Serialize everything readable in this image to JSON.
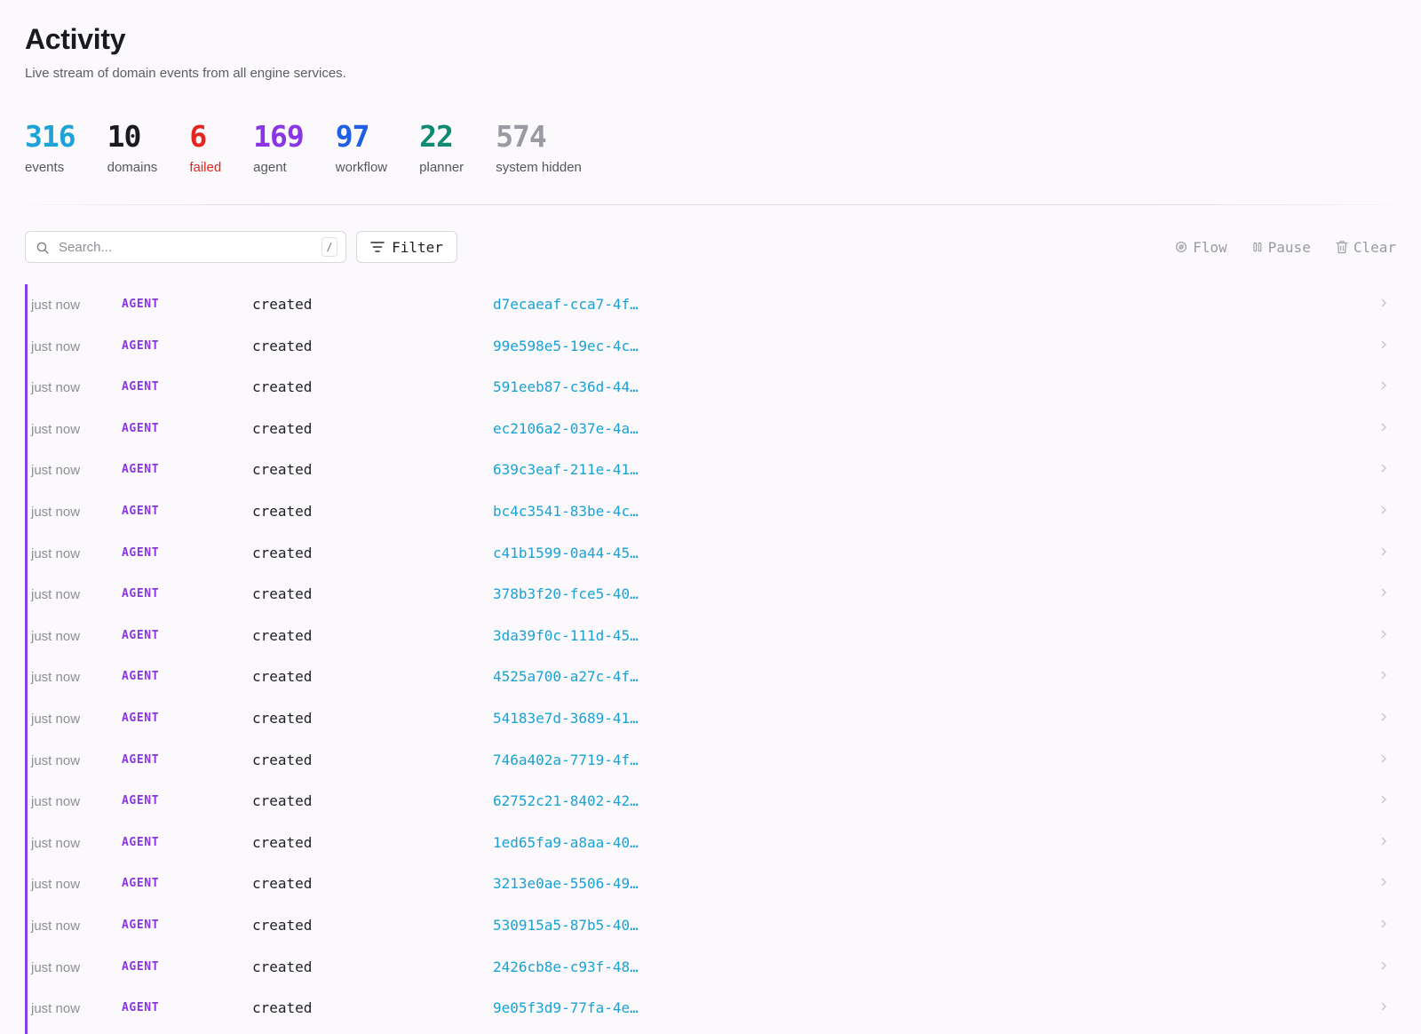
{
  "page": {
    "title": "Activity",
    "subtitle": "Live stream of domain events from all engine services."
  },
  "stats": [
    {
      "value": "316",
      "label": "events",
      "color": "#1da3d8"
    },
    {
      "value": "10",
      "label": "domains",
      "color": "#1a1a1f"
    },
    {
      "value": "6",
      "label": "failed",
      "color": "#e3261f"
    },
    {
      "value": "169",
      "label": "agent",
      "color": "#8a35e6"
    },
    {
      "value": "97",
      "label": "workflow",
      "color": "#1e5fe6"
    },
    {
      "value": "22",
      "label": "planner",
      "color": "#0e8a72"
    },
    {
      "value": "574",
      "label": "system hidden",
      "color": "#9a9aa2"
    }
  ],
  "toolbar": {
    "search_placeholder": "Search...",
    "search_shortcut": "/",
    "filter_label": "Filter",
    "flow_label": "Flow",
    "pause_label": "Pause",
    "clear_label": "Clear"
  },
  "events": [
    {
      "time": "just now",
      "domain": "AGENT",
      "action": "created",
      "id": "d7ecaeaf-cca7-4f…"
    },
    {
      "time": "just now",
      "domain": "AGENT",
      "action": "created",
      "id": "99e598e5-19ec-4c…"
    },
    {
      "time": "just now",
      "domain": "AGENT",
      "action": "created",
      "id": "591eeb87-c36d-44…"
    },
    {
      "time": "just now",
      "domain": "AGENT",
      "action": "created",
      "id": "ec2106a2-037e-4a…"
    },
    {
      "time": "just now",
      "domain": "AGENT",
      "action": "created",
      "id": "639c3eaf-211e-41…"
    },
    {
      "time": "just now",
      "domain": "AGENT",
      "action": "created",
      "id": "bc4c3541-83be-4c…"
    },
    {
      "time": "just now",
      "domain": "AGENT",
      "action": "created",
      "id": "c41b1599-0a44-45…"
    },
    {
      "time": "just now",
      "domain": "AGENT",
      "action": "created",
      "id": "378b3f20-fce5-40…"
    },
    {
      "time": "just now",
      "domain": "AGENT",
      "action": "created",
      "id": "3da39f0c-111d-45…"
    },
    {
      "time": "just now",
      "domain": "AGENT",
      "action": "created",
      "id": "4525a700-a27c-4f…"
    },
    {
      "time": "just now",
      "domain": "AGENT",
      "action": "created",
      "id": "54183e7d-3689-41…"
    },
    {
      "time": "just now",
      "domain": "AGENT",
      "action": "created",
      "id": "746a402a-7719-4f…"
    },
    {
      "time": "just now",
      "domain": "AGENT",
      "action": "created",
      "id": "62752c21-8402-42…"
    },
    {
      "time": "just now",
      "domain": "AGENT",
      "action": "created",
      "id": "1ed65fa9-a8aa-40…"
    },
    {
      "time": "just now",
      "domain": "AGENT",
      "action": "created",
      "id": "3213e0ae-5506-49…"
    },
    {
      "time": "just now",
      "domain": "AGENT",
      "action": "created",
      "id": "530915a5-87b5-40…"
    },
    {
      "time": "just now",
      "domain": "AGENT",
      "action": "created",
      "id": "2426cb8e-c93f-48…"
    },
    {
      "time": "just now",
      "domain": "AGENT",
      "action": "created",
      "id": "9e05f3d9-77fa-4e…"
    }
  ]
}
